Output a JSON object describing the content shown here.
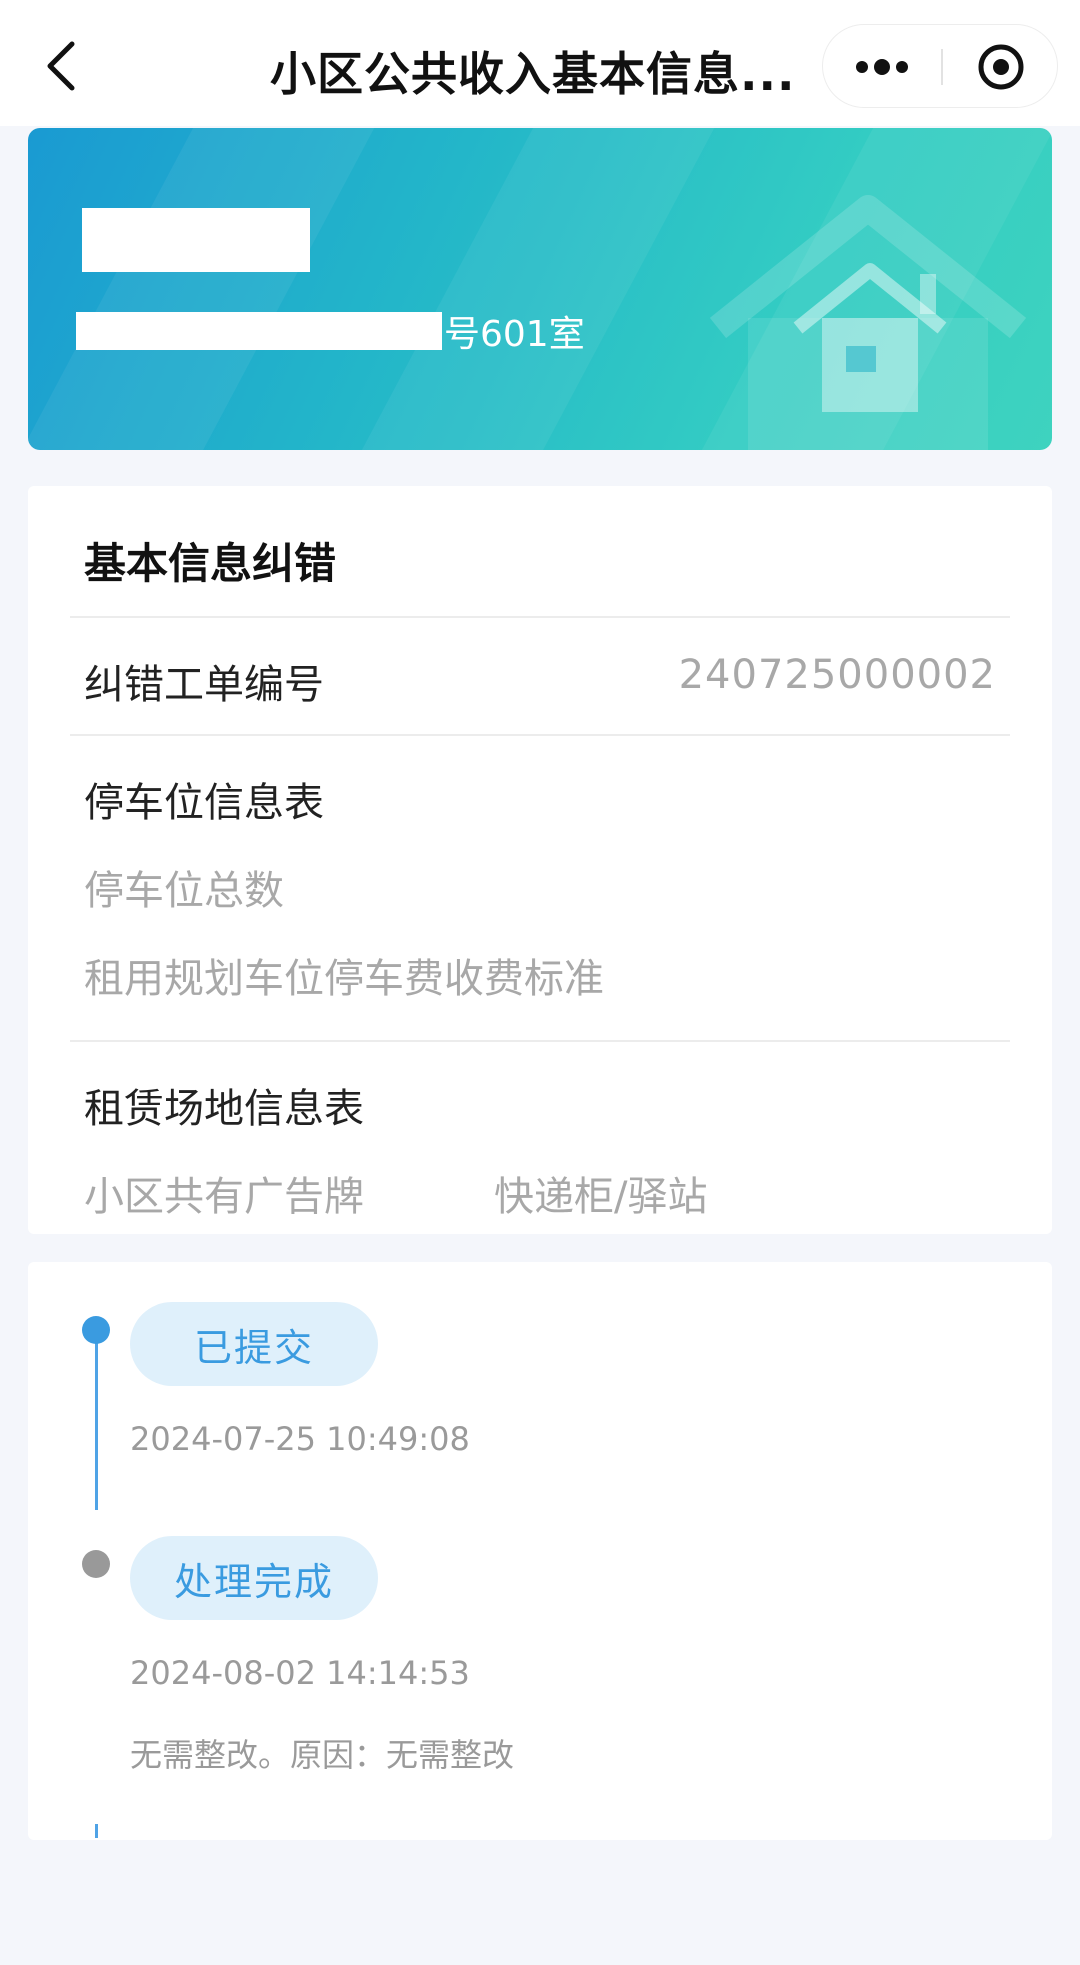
{
  "nav": {
    "title": "小区公共收入基本信息...",
    "back_icon": "chevron-left-icon",
    "more_icon": "more-dots-icon",
    "close_icon": "target-circle-icon"
  },
  "banner": {
    "address_suffix": "号601室",
    "gradient_start": "#1a9ad2",
    "gradient_end": "#3ed3bf"
  },
  "info": {
    "title": "基本信息纠错",
    "ticket_label": "纠错工单编号",
    "ticket_value": "240725000002",
    "parking": {
      "title": "停车位信息表",
      "items": [
        "停车位总数",
        "租用规划车位停车费收费标准"
      ]
    },
    "lease": {
      "title": "租赁场地信息表",
      "items": [
        "小区共有广告牌",
        "快递柜/驿站"
      ]
    }
  },
  "timeline": [
    {
      "status": "已提交",
      "time": "2024-07-25 10:49:08",
      "note": "",
      "dot_color": "#3a9be0"
    },
    {
      "status": "处理完成",
      "time": "2024-08-02 14:14:53",
      "note": "无需整改。原因：无需整改",
      "dot_color": "#999999"
    }
  ],
  "colors": {
    "accent": "#3a9be0",
    "muted_text": "#a8a8a8",
    "page_bg": "#f4f6fb"
  }
}
